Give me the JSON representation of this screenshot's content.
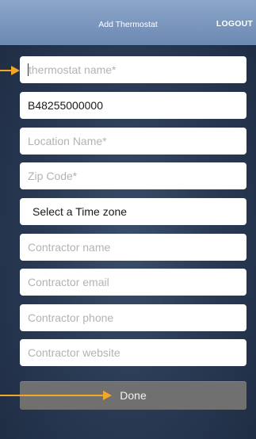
{
  "header": {
    "title": "Add Thermostat",
    "logout_label": "LOGOUT"
  },
  "form": {
    "thermostat_name_placeholder": "thermostat name*",
    "serial_value": "B48255000000",
    "location_name_placeholder": "Location Name*",
    "zip_code_placeholder": "Zip Code*",
    "time_zone_select": "Select a Time zone",
    "contractor_name_placeholder": "Contractor name",
    "contractor_email_placeholder": "Contractor email",
    "contractor_phone_placeholder": "Contractor phone",
    "contractor_website_placeholder": "Contractor website"
  },
  "done_label": "Done",
  "colors": {
    "header_bg": "#7d98c0",
    "annotation_arrow": "#f5a623",
    "done_button": "#707070"
  }
}
